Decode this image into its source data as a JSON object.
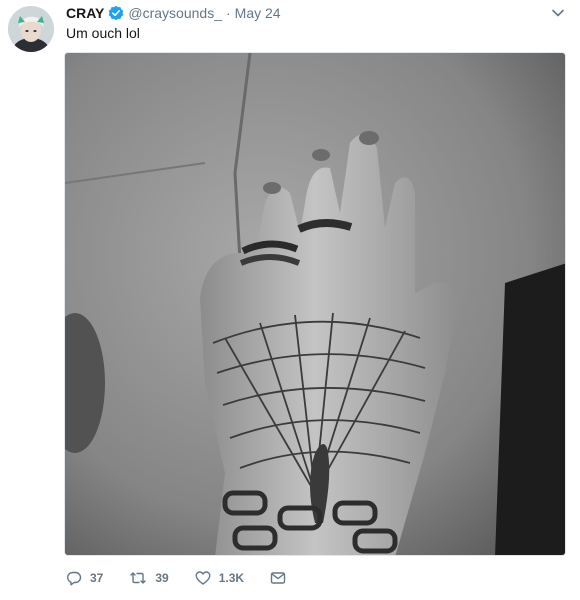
{
  "tweet": {
    "display_name": "CRAY",
    "handle": "@craysounds_",
    "separator": "·",
    "timestamp": "May 24",
    "text": "Um ouch lol",
    "verified": true,
    "icons": {
      "verified": "verified-badge-icon",
      "menu": "chevron-down-icon",
      "reply": "reply-icon",
      "retweet": "retweet-icon",
      "like": "heart-icon",
      "dm": "envelope-icon"
    },
    "actions": {
      "reply_count": "37",
      "retweet_count": "39",
      "like_count": "1.3K"
    }
  },
  "colors": {
    "verified": "#1da1f2",
    "text": "#14171a",
    "secondary": "#657786"
  }
}
